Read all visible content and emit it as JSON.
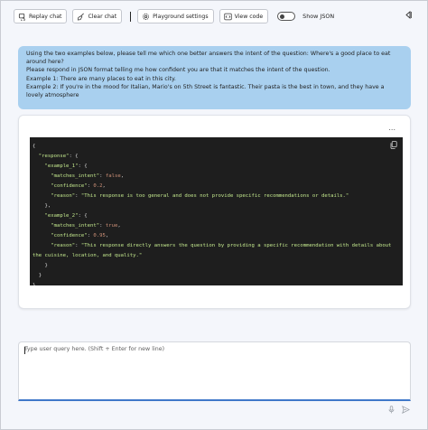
{
  "toolbar": {
    "replay_label": "Replay chat",
    "clear_label": "Clear chat",
    "settings_label": "Playground settings",
    "view_code_label": "View code",
    "show_json_label": "Show JSON"
  },
  "user_message": {
    "lines": [
      "Using the two examples below, please tell me which one better answers the intent of the question: Where's a good place to eat around here?",
      "Please respond in JSON format telling me how confident you are that it matches the intent of the question.",
      "Example 1: There are many places to eat in this city.",
      "Example 2: If you're in the mood for Italian, Mario's on 5th Street is fantastic. Their pasta is the best in town, and they have a lovely atmosphere"
    ]
  },
  "response": {
    "more_label": "...",
    "code": {
      "open": "{",
      "response_key": "\"response\"",
      "ex1_key": "\"example_1\"",
      "matches_key": "\"matches_intent\"",
      "ex1_matches": "false",
      "confidence_key": "\"confidence\"",
      "ex1_confidence": "0.2",
      "reason_key": "\"reason\"",
      "ex1_reason": "\"This response is too general and does not provide specific recommendations or details.\"",
      "ex2_key": "\"example_2\"",
      "ex2_matches": "true",
      "ex2_confidence": "0.95",
      "ex2_reason": "\"This response directly answers the question by providing a specific recommendation with details about the cuisine, location, and quality.\""
    }
  },
  "input": {
    "placeholder": "Type user query here. (Shift + Enter for new line)"
  }
}
